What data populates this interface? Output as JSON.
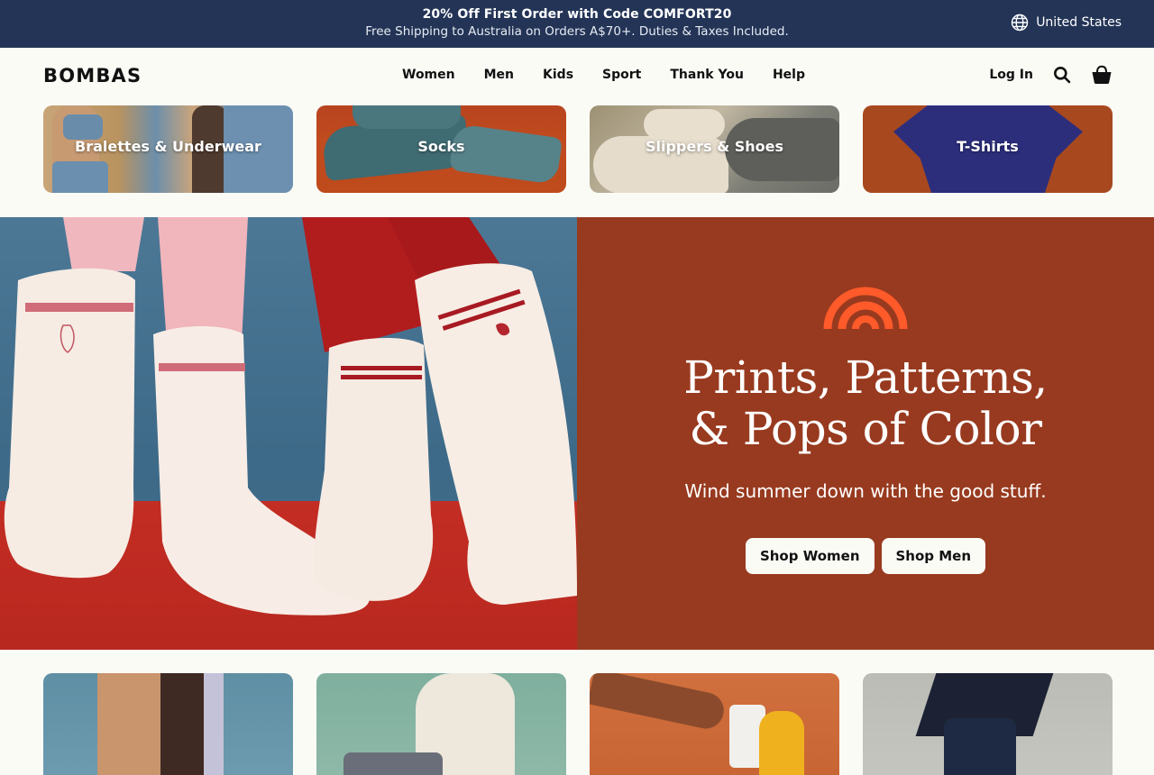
{
  "promo": {
    "line1": "20% Off First Order with Code COMFORT20",
    "line2": "Free Shipping to Australia on Orders A$70+. Duties & Taxes Included.",
    "region": "United States",
    "background": "#233456"
  },
  "header": {
    "logo": "BOMBAS",
    "nav": [
      "Women",
      "Men",
      "Kids",
      "Sport",
      "Thank You",
      "Help"
    ],
    "login": "Log In",
    "icons": [
      "search-icon",
      "cart-icon",
      "globe-icon"
    ]
  },
  "categories": [
    {
      "label": "Bralettes & Underwear"
    },
    {
      "label": "Socks"
    },
    {
      "label": "Slippers & Shoes"
    },
    {
      "label": "T-Shirts"
    }
  ],
  "hero": {
    "title_line1": "Prints, Patterns,",
    "title_line2": "& Pops of Color",
    "subtitle": "Wind summer down with the good stuff.",
    "buttons": [
      "Shop Women",
      "Shop Men"
    ],
    "panel_color": "#983a1f",
    "accent_color": "#ff5a2a"
  },
  "products": [
    {
      "image": "legs-tall-socks"
    },
    {
      "image": "person-sitting-sweater"
    },
    {
      "image": "runner-yellow-shoe"
    },
    {
      "image": "navy-dress-sock"
    }
  ]
}
